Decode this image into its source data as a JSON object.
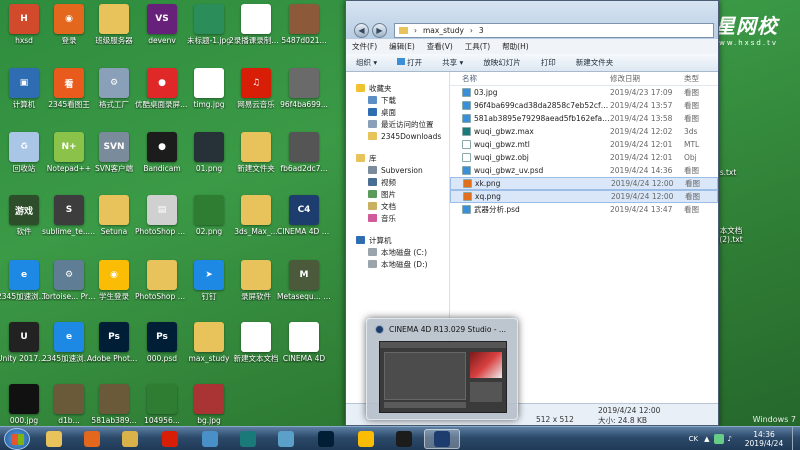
{
  "desktop": {
    "icons": [
      {
        "label": "hxsd",
        "color": "#d14a2b",
        "text": "H"
      },
      {
        "label": "登录",
        "color": "#e3681d",
        "text": "◉"
      },
      {
        "label": "班级服务器",
        "color": "#e8c25a",
        "text": ""
      },
      {
        "label": "devenv",
        "color": "#68217a",
        "text": "VS"
      },
      {
        "label": "未标题-1.jpg",
        "color": "#2a8d5a",
        "text": ""
      },
      {
        "label": "2录播课录制注意事项...",
        "color": "#ffffff",
        "text": ""
      },
      {
        "label": "5487d021...",
        "color": "#8c5a3a",
        "text": ""
      },
      {
        "label": "计算机",
        "color": "#2f6db3",
        "text": "▣"
      },
      {
        "label": "2345看图王",
        "color": "#e85b1c",
        "text": "看"
      },
      {
        "label": "格式工厂",
        "color": "#8aa0b8",
        "text": "⚙"
      },
      {
        "label": "优酷桌面录屏 v6.9.1 ...",
        "color": "#e02828",
        "text": "●"
      },
      {
        "label": "timg.jpg",
        "color": "#ffffff",
        "text": ""
      },
      {
        "label": "网易云音乐",
        "color": "#d81e06",
        "text": "♫"
      },
      {
        "label": "96f4ba699...",
        "color": "#6a6a6a",
        "text": ""
      },
      {
        "label": "回收站",
        "color": "#a9c6e6",
        "text": "♻"
      },
      {
        "label": "Notepad++",
        "color": "#8bc34a",
        "text": "N+"
      },
      {
        "label": "SVN客户端",
        "color": "#7a8b9c",
        "text": "SVN"
      },
      {
        "label": "Bandicam",
        "color": "#1c1c1c",
        "text": "●"
      },
      {
        "label": "01.png",
        "color": "#263238",
        "text": ""
      },
      {
        "label": "新建文件夹",
        "color": "#e8c25a",
        "text": ""
      },
      {
        "label": "fb6ad2dc7...",
        "color": "#555555",
        "text": ""
      },
      {
        "label": "软件",
        "color": "#2e4d2a",
        "text": "游戏"
      },
      {
        "label": "sublime_te... - 快捷方式",
        "color": "#3d3d3d",
        "text": "S"
      },
      {
        "label": "Setuna",
        "color": "#e8c25a",
        "text": ""
      },
      {
        "label": "PhotoShop CS6 无需...",
        "color": "#d0d0d0",
        "text": "▤"
      },
      {
        "label": "02.png",
        "color": "#2e7d32",
        "text": ""
      },
      {
        "label": "3ds_Max_...",
        "color": "#e8c25a",
        "text": ""
      },
      {
        "label": "CINEMA 4D 64 Bit.exe ...",
        "color": "#1c3d6e",
        "text": "C4"
      },
      {
        "label": "2345加速浏览器",
        "color": "#1e88e5",
        "text": "e"
      },
      {
        "label": "Tortoise... Project ...",
        "color": "#5f7d95",
        "text": "⚙"
      },
      {
        "label": "学生登录",
        "color": "#fbbc05",
        "text": "◉"
      },
      {
        "label": "PhotoShop CS6 无需...",
        "color": "#e8c25a",
        "text": ""
      },
      {
        "label": "钉钉",
        "color": "#1e88e5",
        "text": "➤"
      },
      {
        "label": "录屏软件",
        "color": "#e8c25a",
        "text": ""
      },
      {
        "label": "Metasequ... 4 (64bit)",
        "color": "#4a5a3a",
        "text": "M"
      },
      {
        "label": "Unity 2017.3.0...",
        "color": "#222222",
        "text": "U"
      },
      {
        "label": "2345加速浏览器",
        "color": "#1e88e5",
        "text": "e"
      },
      {
        "label": "Adobe Photosh...",
        "color": "#001e36",
        "text": "Ps"
      },
      {
        "label": "000.psd",
        "color": "#001e36",
        "text": "Ps"
      },
      {
        "label": "max_study",
        "color": "#e8c25a",
        "text": ""
      },
      {
        "label": "新建文本文档",
        "color": "#ffffff",
        "text": ""
      },
      {
        "label": "CINEMA 4D",
        "color": "#ffffff",
        "text": ""
      },
      {
        "label": "000.jpg",
        "color": "#111111",
        "text": ""
      },
      {
        "label": "d1b...",
        "color": "#6a5a3a",
        "text": ""
      },
      {
        "label": "581ab389...",
        "color": "#6a5a3a",
        "text": ""
      },
      {
        "label": "104956...",
        "color": "#2e7d32",
        "text": ""
      },
      {
        "label": "bg.jpg",
        "color": "#aa3333",
        "text": ""
      }
    ],
    "right_fragments": {
      "a": "s.txt",
      "b": "本文档 (2).txt"
    }
  },
  "brand": {
    "name": "火星网校",
    "url": "www.hxsd.tv"
  },
  "explorer": {
    "breadcrumb": [
      "max_study",
      "3"
    ],
    "menu": [
      "文件(F)",
      "编辑(E)",
      "查看(V)",
      "工具(T)",
      "帮助(H)"
    ],
    "toolbar": [
      "组织 ▾",
      "打开",
      "共享 ▾",
      "放映幻灯片",
      "打印",
      "新建文件夹"
    ],
    "nav": {
      "favorites": "收藏夹",
      "downloads": "下载",
      "desktop": "桌面",
      "recent": "最近访问的位置",
      "cloud": "2345Downloads",
      "library": "库",
      "subversion": "Subversion",
      "video": "视频",
      "pictures": "图片",
      "docs": "文档",
      "music": "音乐",
      "computer": "计算机",
      "disk_c": "本地磁盘 (C:)",
      "disk_d": "本地磁盘 (D:)"
    },
    "columns": {
      "name": "名称",
      "date": "修改日期",
      "type": "类型"
    },
    "files": [
      {
        "name": "03.jpg",
        "date": "2019/4/23 17:09",
        "type": "看图",
        "icon": "#3b8fd8",
        "sel": false
      },
      {
        "name": "96f4ba699cad38da2858c7eb52cf92b...",
        "date": "2019/4/24 13:57",
        "type": "看图",
        "icon": "#3b8fd8",
        "sel": false
      },
      {
        "name": "581ab3895e79298aead5fb162efa574...",
        "date": "2019/4/24 13:58",
        "type": "看图",
        "icon": "#3b8fd8",
        "sel": false
      },
      {
        "name": "wuqi_gbwz.max",
        "date": "2019/4/24 12:02",
        "type": "3ds",
        "icon": "#1a7a7a",
        "sel": false
      },
      {
        "name": "wuqi_gbwz.mtl",
        "date": "2019/4/24 12:01",
        "type": "MTL",
        "icon": "#ffffff",
        "sel": false
      },
      {
        "name": "wuqi_gbwz.obj",
        "date": "2019/4/24 12:01",
        "type": "Obj",
        "icon": "#ffffff",
        "sel": false
      },
      {
        "name": "wuqi_gbwz_uv.psd",
        "date": "2019/4/24 14:36",
        "type": "看图",
        "icon": "#3b8fd8",
        "sel": false
      },
      {
        "name": "xk.png",
        "date": "2019/4/24 12:00",
        "type": "看图",
        "icon": "#e07020",
        "sel": true
      },
      {
        "name": "xq.png",
        "date": "2019/4/24 12:00",
        "type": "看图",
        "icon": "#e07020",
        "sel": true
      },
      {
        "name": "武器分析.psd",
        "date": "2019/4/24 13:47",
        "type": "看图",
        "icon": "#3b8fd8",
        "sel": false
      }
    ],
    "status": {
      "size": "大小: 24.8 KB",
      "dims": "512 x 512",
      "date": "2019/4/24 12:00"
    }
  },
  "thumbnail": {
    "title": "CINEMA 4D R13.029 Studio - ..."
  },
  "watermark": "Windows 7",
  "taskbar": {
    "ime": "CK",
    "time": "14:36",
    "date": "2019/4/24"
  }
}
